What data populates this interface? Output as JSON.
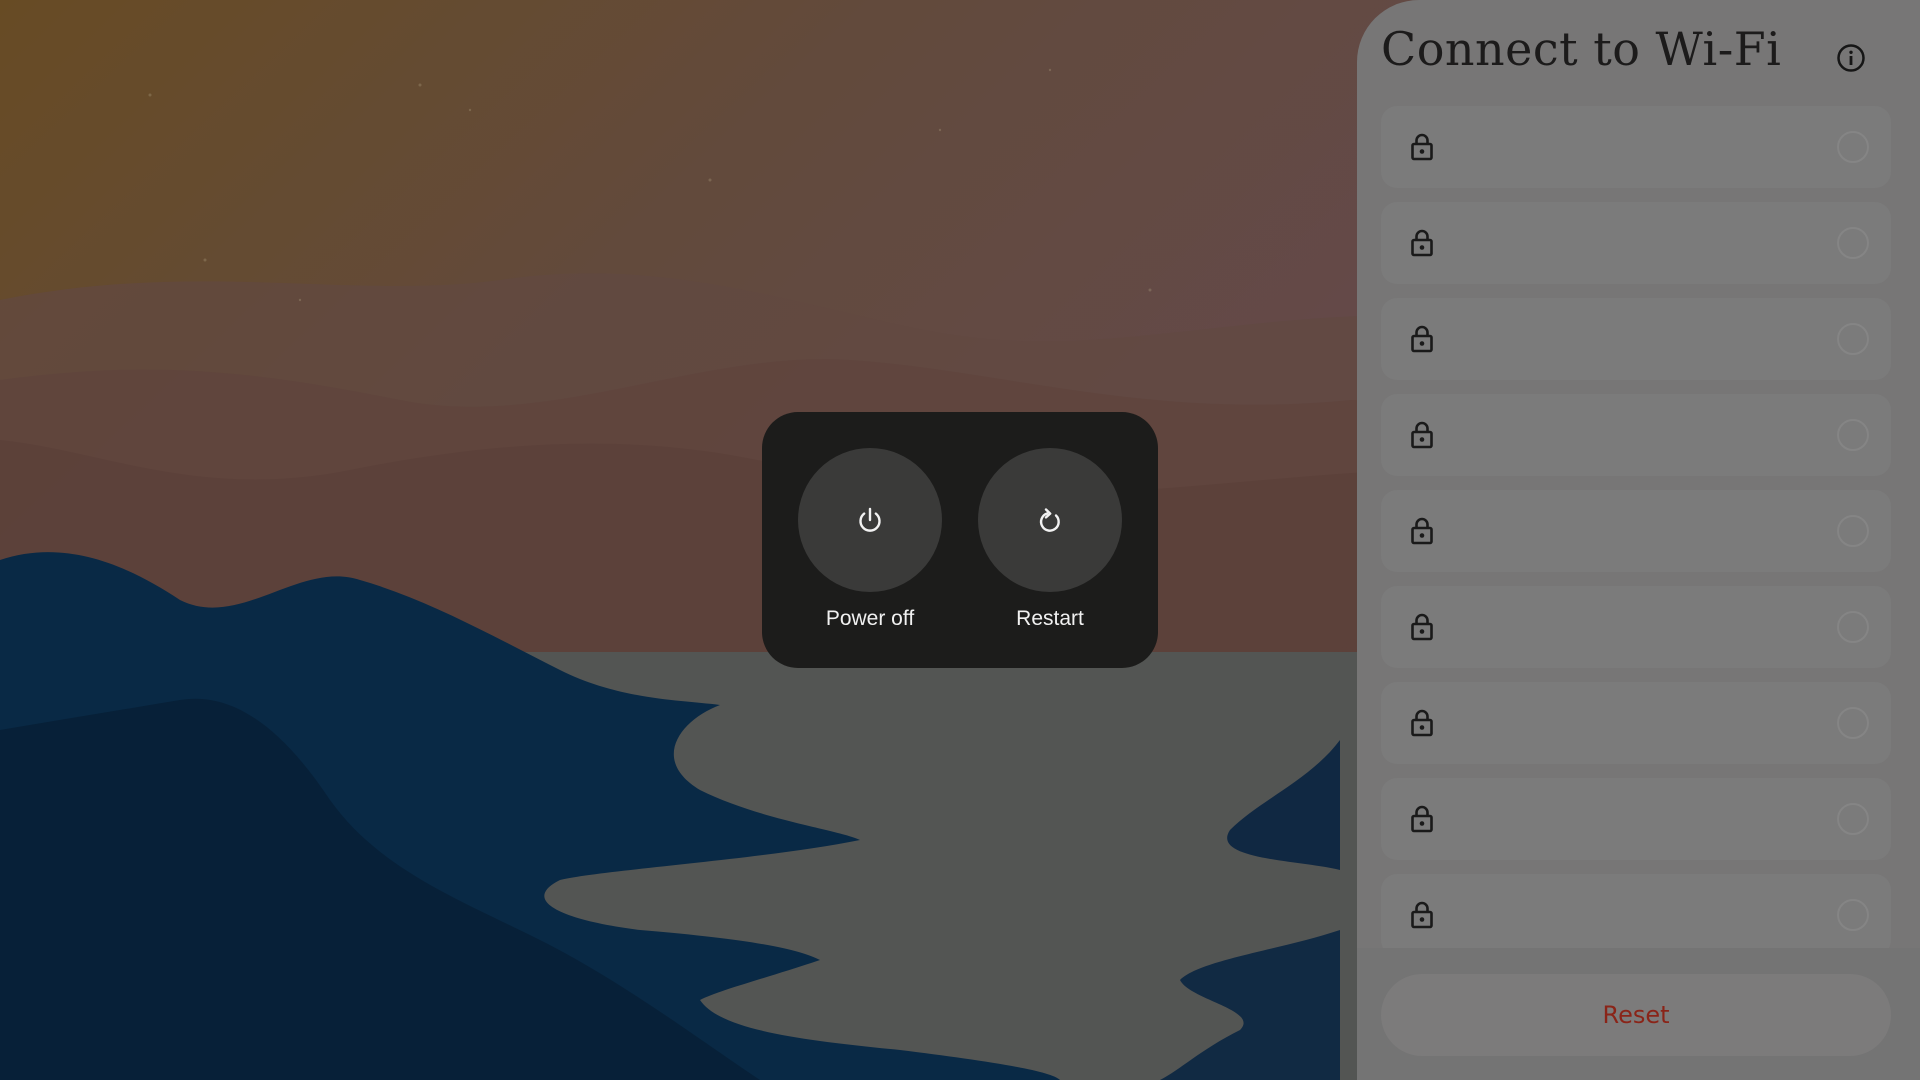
{
  "power_menu": {
    "power_off_label": "Power off",
    "restart_label": "Restart",
    "power_off_icon": "power-icon",
    "restart_icon": "restart-icon"
  },
  "wifi_panel": {
    "title": "Connect to Wi-Fi",
    "info_icon": "info-icon",
    "networks": [
      {
        "name": "",
        "secured": true,
        "selected": false
      },
      {
        "name": "",
        "secured": true,
        "selected": false
      },
      {
        "name": "",
        "secured": true,
        "selected": false
      },
      {
        "name": "",
        "secured": true,
        "selected": false
      },
      {
        "name": "",
        "secured": true,
        "selected": false
      },
      {
        "name": "",
        "secured": true,
        "selected": false
      },
      {
        "name": "",
        "secured": true,
        "selected": false
      },
      {
        "name": "",
        "secured": true,
        "selected": false
      },
      {
        "name": "",
        "secured": true,
        "selected": false
      }
    ],
    "reset_label": "Reset"
  },
  "colors": {
    "reset_text": "#8a2418",
    "dialog_background": "#1c1c1b",
    "dialog_button": "#3a3a39",
    "panel_background": "#777676"
  }
}
